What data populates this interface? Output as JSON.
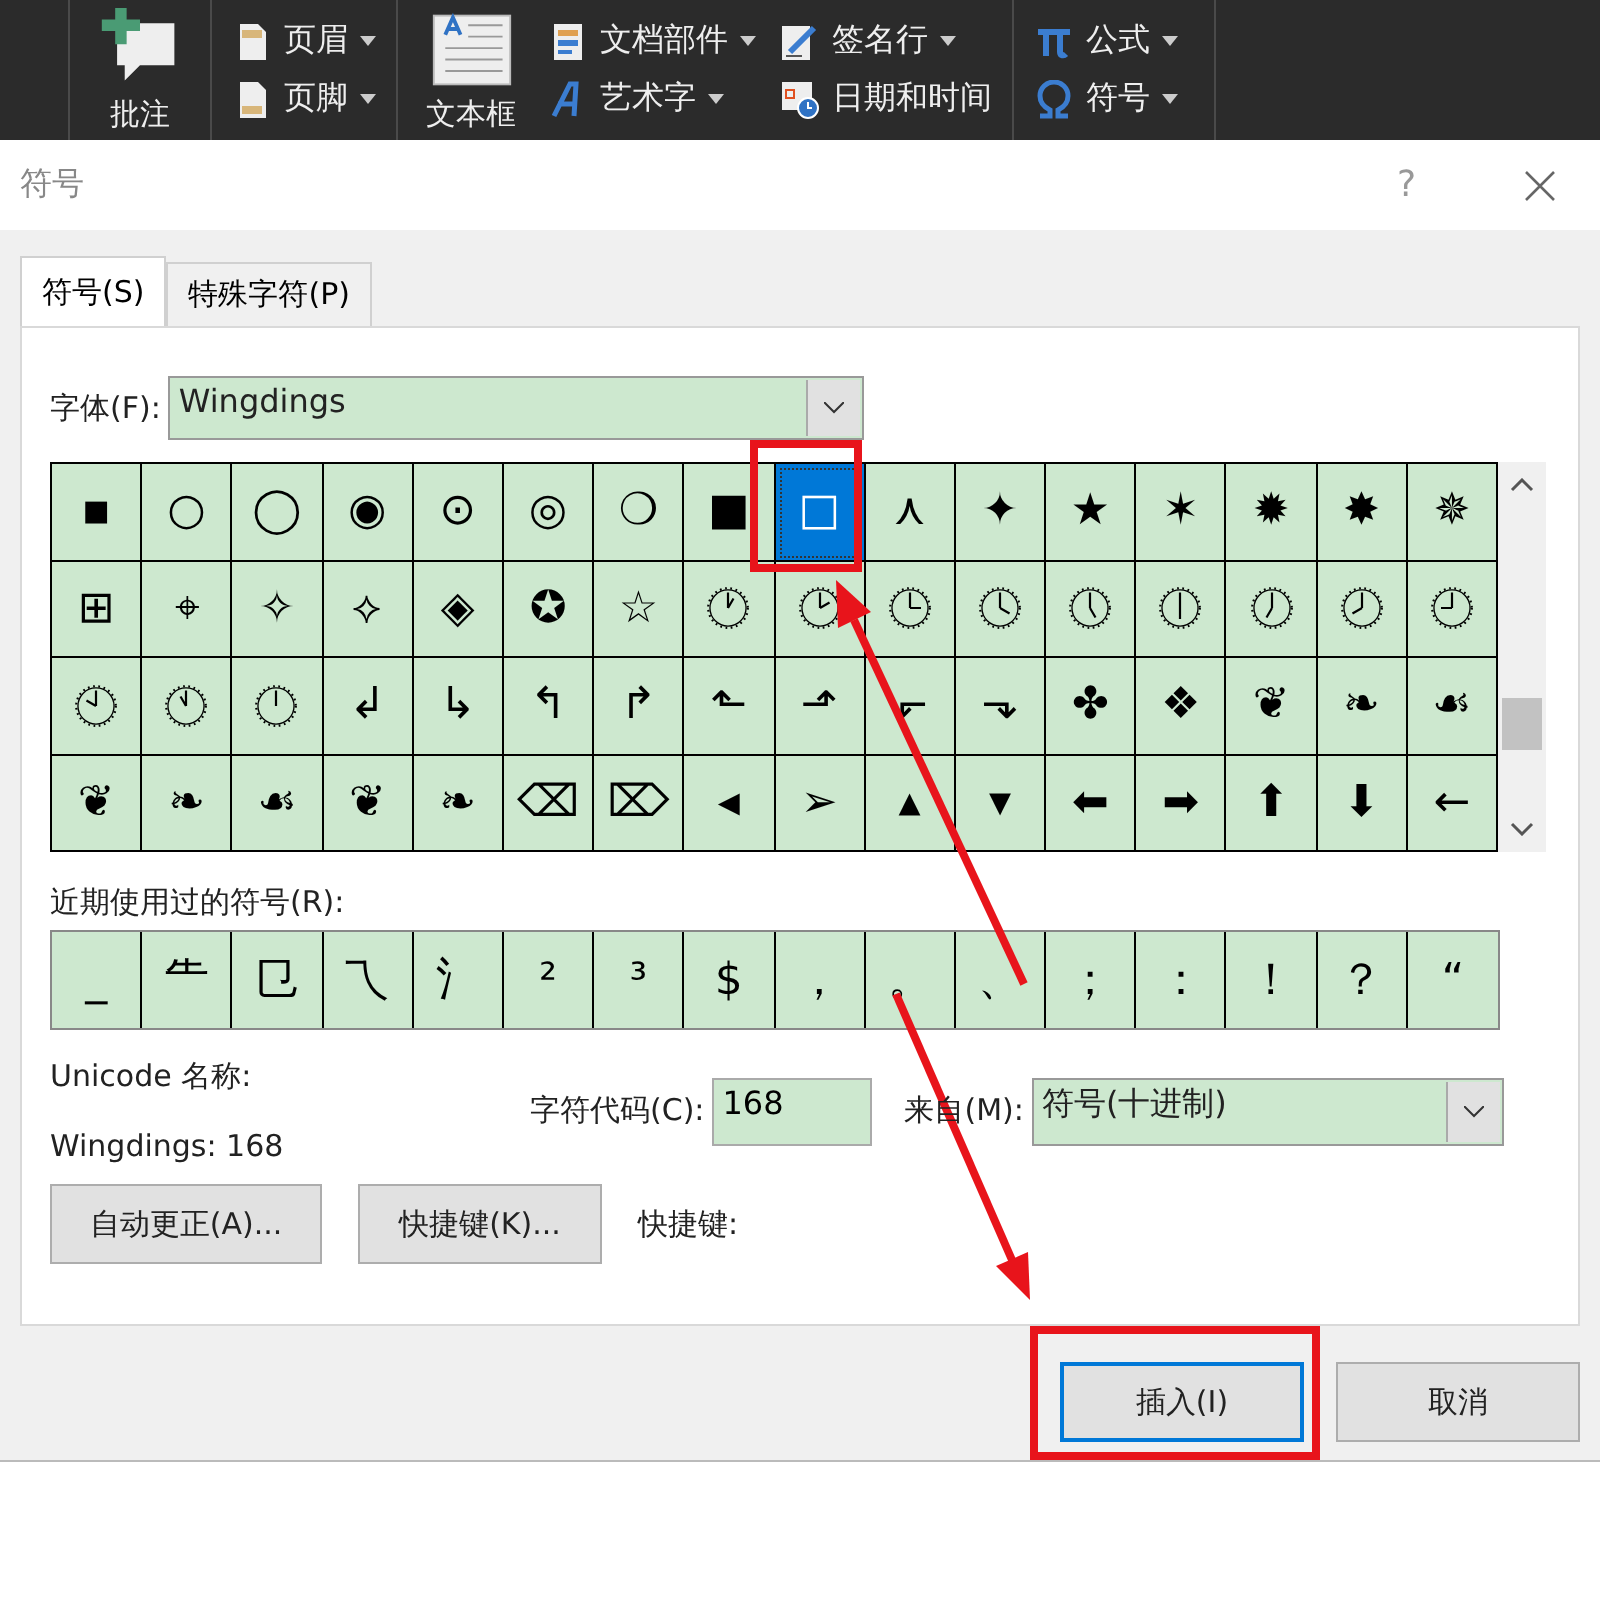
{
  "ribbon": {
    "groups": [
      {
        "columns": [
          [
            {
              "kind": "comment",
              "label": "批注",
              "has_menu": false
            }
          ]
        ]
      },
      {
        "columns": [
          [
            {
              "kind": "header",
              "label": "页眉",
              "has_menu": true
            },
            {
              "kind": "footer",
              "label": "页脚",
              "has_menu": true
            }
          ]
        ]
      },
      {
        "columns": [
          [
            {
              "kind": "textbox",
              "label": "文本框",
              "has_menu": false
            }
          ],
          [
            {
              "kind": "parts",
              "label": "文档部件",
              "has_menu": true
            },
            {
              "kind": "wordart",
              "label": "艺术字",
              "has_menu": true
            }
          ],
          [
            {
              "kind": "signature",
              "label": "签名行",
              "has_menu": true
            },
            {
              "kind": "datetime",
              "label": "日期和时间",
              "has_menu": false
            }
          ]
        ]
      },
      {
        "columns": [
          [
            {
              "kind": "equation",
              "label": "公式",
              "has_menu": true
            },
            {
              "kind": "symbol",
              "label": "符号",
              "has_menu": true
            }
          ]
        ]
      }
    ]
  },
  "dialog": {
    "title": "符号",
    "help": "?"
  },
  "tabs": [
    {
      "label": "符号(S)",
      "selected": true
    },
    {
      "label": "特殊字符(P)",
      "selected": false
    }
  ],
  "font": {
    "label": "字体(F):",
    "value": "Wingdings"
  },
  "symbols": {
    "rows": [
      [
        {
          "kind": "glyph",
          "glyph": "▪",
          "selected": false
        },
        {
          "kind": "glyph",
          "glyph": "○",
          "selected": false
        },
        {
          "kind": "glyph",
          "glyph": "◯",
          "selected": false
        },
        {
          "kind": "glyph",
          "glyph": "◉",
          "selected": false
        },
        {
          "kind": "glyph",
          "glyph": "⊙",
          "selected": false
        },
        {
          "kind": "glyph",
          "glyph": "◎",
          "selected": false
        },
        {
          "kind": "glyph",
          "glyph": "❍",
          "selected": false
        },
        {
          "kind": "glyph",
          "glyph": "■",
          "selected": false
        },
        {
          "kind": "glyph",
          "glyph": "□",
          "selected": true
        },
        {
          "kind": "glyph",
          "glyph": "⋏",
          "selected": false
        },
        {
          "kind": "glyph",
          "glyph": "✦",
          "selected": false
        },
        {
          "kind": "glyph",
          "glyph": "★",
          "selected": false
        },
        {
          "kind": "glyph",
          "glyph": "✶",
          "selected": false
        },
        {
          "kind": "glyph",
          "glyph": "✹",
          "selected": false
        },
        {
          "kind": "glyph",
          "glyph": "✸",
          "selected": false
        },
        {
          "kind": "glyph",
          "glyph": "✵",
          "selected": false
        }
      ],
      [
        {
          "kind": "glyph",
          "glyph": "⊞",
          "selected": false
        },
        {
          "kind": "glyph",
          "glyph": "⌖",
          "selected": false
        },
        {
          "kind": "glyph",
          "glyph": "✧",
          "selected": false
        },
        {
          "kind": "glyph",
          "glyph": "⟡",
          "selected": false
        },
        {
          "kind": "glyph",
          "glyph": "◈",
          "selected": false
        },
        {
          "kind": "glyph",
          "glyph": "✪",
          "selected": false
        },
        {
          "kind": "glyph",
          "glyph": "☆",
          "selected": false
        },
        {
          "kind": "clock",
          "selected": false
        },
        {
          "kind": "clock",
          "selected": false
        },
        {
          "kind": "clock",
          "selected": false
        },
        {
          "kind": "clock",
          "selected": false
        },
        {
          "kind": "clock",
          "selected": false
        },
        {
          "kind": "clock",
          "selected": false
        },
        {
          "kind": "clock",
          "selected": false
        },
        {
          "kind": "clock",
          "selected": false
        },
        {
          "kind": "clock",
          "selected": false
        }
      ],
      [
        {
          "kind": "clock",
          "selected": false
        },
        {
          "kind": "clock",
          "selected": false
        },
        {
          "kind": "clock",
          "selected": false
        },
        {
          "kind": "glyph",
          "glyph": "↲",
          "selected": false
        },
        {
          "kind": "glyph",
          "glyph": "↳",
          "selected": false
        },
        {
          "kind": "glyph",
          "glyph": "↰",
          "selected": false
        },
        {
          "kind": "glyph",
          "glyph": "↱",
          "selected": false
        },
        {
          "kind": "glyph",
          "glyph": "⬑",
          "selected": false
        },
        {
          "kind": "glyph",
          "glyph": "⬏",
          "selected": false
        },
        {
          "kind": "glyph",
          "glyph": "⬐",
          "selected": false
        },
        {
          "kind": "glyph",
          "glyph": "⬎",
          "selected": false
        },
        {
          "kind": "glyph",
          "glyph": "✤",
          "selected": false
        },
        {
          "kind": "glyph",
          "glyph": "❖",
          "selected": false
        },
        {
          "kind": "glyph",
          "glyph": "❦",
          "selected": false
        },
        {
          "kind": "glyph",
          "glyph": "❧",
          "selected": false
        },
        {
          "kind": "glyph",
          "glyph": "☙",
          "selected": false
        }
      ],
      [
        {
          "kind": "glyph",
          "glyph": "❦",
          "selected": false
        },
        {
          "kind": "glyph",
          "glyph": "❧",
          "selected": false
        },
        {
          "kind": "glyph",
          "glyph": "☙",
          "selected": false
        },
        {
          "kind": "glyph",
          "glyph": "❦",
          "selected": false
        },
        {
          "kind": "glyph",
          "glyph": "❧",
          "selected": false
        },
        {
          "kind": "glyph",
          "glyph": "⌫",
          "selected": false
        },
        {
          "kind": "glyph",
          "glyph": "⌦",
          "selected": false
        },
        {
          "kind": "glyph",
          "glyph": "◂",
          "selected": false
        },
        {
          "kind": "glyph",
          "glyph": "➢",
          "selected": false
        },
        {
          "kind": "glyph",
          "glyph": "▴",
          "selected": false
        },
        {
          "kind": "glyph",
          "glyph": "▾",
          "selected": false
        },
        {
          "kind": "glyph",
          "glyph": "⬅",
          "selected": false
        },
        {
          "kind": "glyph",
          "glyph": "➡",
          "selected": false
        },
        {
          "kind": "glyph",
          "glyph": "⬆",
          "selected": false
        },
        {
          "kind": "glyph",
          "glyph": "⬇",
          "selected": false
        },
        {
          "kind": "glyph",
          "glyph": "←",
          "selected": false
        }
      ]
    ]
  },
  "recent": {
    "label": "近期使用过的符号(R):",
    "symbols": [
      "_",
      "⺧",
      "㔾",
      "乁",
      "氵",
      "²",
      "³",
      "$",
      "，",
      "。",
      "、",
      "；",
      "：",
      "！",
      "？",
      "“"
    ]
  },
  "info": {
    "unicode_name_label": "Unicode 名称:",
    "unicode_name": "Wingdings: 168",
    "code_label": "字符代码(C):",
    "code": "168",
    "from_label": "来自(M):",
    "from": "符号(十进制)"
  },
  "actions": {
    "autocorrect": "自动更正(A)...",
    "shortcut_key": "快捷键(K)...",
    "shortcut_label": "快捷键:"
  },
  "buttons": [
    {
      "label": "插入(I)",
      "default": true
    },
    {
      "label": "取消",
      "default": false
    }
  ]
}
